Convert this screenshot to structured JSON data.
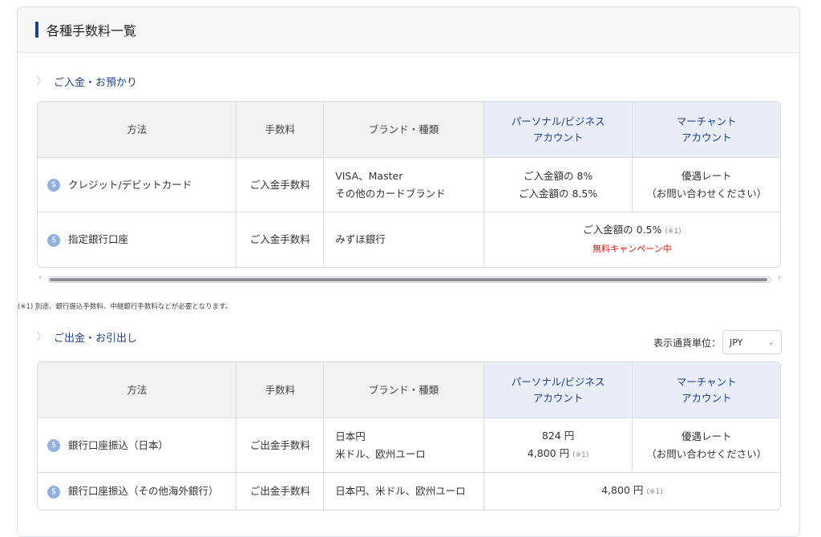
{
  "panel": {
    "title": "各種手数料一覧"
  },
  "deposit": {
    "section_title": "ご入金・お預かり",
    "headers": [
      "方法",
      "手数料",
      "ブランド・種類",
      "パーソナル/ビジネス\nアカウント",
      "マーチャント\nアカウント"
    ],
    "rows": [
      {
        "method": "クレジット/デビットカード",
        "fee": "ご入金手数料",
        "brand": [
          "VISA、Master",
          "その他のカードブランド"
        ],
        "personal": [
          "ご入金額の 8%",
          "ご入金額の 8.5%"
        ],
        "merchant": [
          "優遇レート",
          "（お問い合わせください）"
        ]
      },
      {
        "method": "指定銀行口座",
        "fee": "ご入金手数料",
        "brand": [
          "みずほ銀行"
        ],
        "combined": "ご入金額の 0.5%",
        "combined_note": "(※1)",
        "campaign": "無料キャンペーン中"
      }
    ]
  },
  "footnote": "(※1) 別途、銀行振込手数料、中継銀行手数料などが必要となります。",
  "withdraw": {
    "section_title": "ご出金・お引出し",
    "currency_label": "表示通貨単位：",
    "currency_value": "JPY",
    "headers": [
      "方法",
      "手数料",
      "ブランド・種類",
      "パーソナル/ビジネス\nアカウント",
      "マーチャント\nアカウント"
    ],
    "rows": [
      {
        "method": "銀行口座振込（日本）",
        "fee": "ご出金手数料",
        "brand": [
          "日本円",
          "米ドル、欧州ユーロ"
        ],
        "personal": [
          "824 円",
          "4,800 円"
        ],
        "personal_note": "(※1)",
        "merchant": [
          "優遇レート",
          "（お問い合わせください）"
        ]
      },
      {
        "method": "銀行口座振込（その他海外銀行）",
        "fee": "ご出金手数料",
        "brand": [
          "日本円、米ドル、欧州ユーロ"
        ],
        "combined": "4,800 円",
        "combined_note": "(※1)"
      }
    ]
  },
  "icons": {
    "method_icon": "dollar-circle-icon",
    "section_icon": "chevron-right-icon"
  }
}
